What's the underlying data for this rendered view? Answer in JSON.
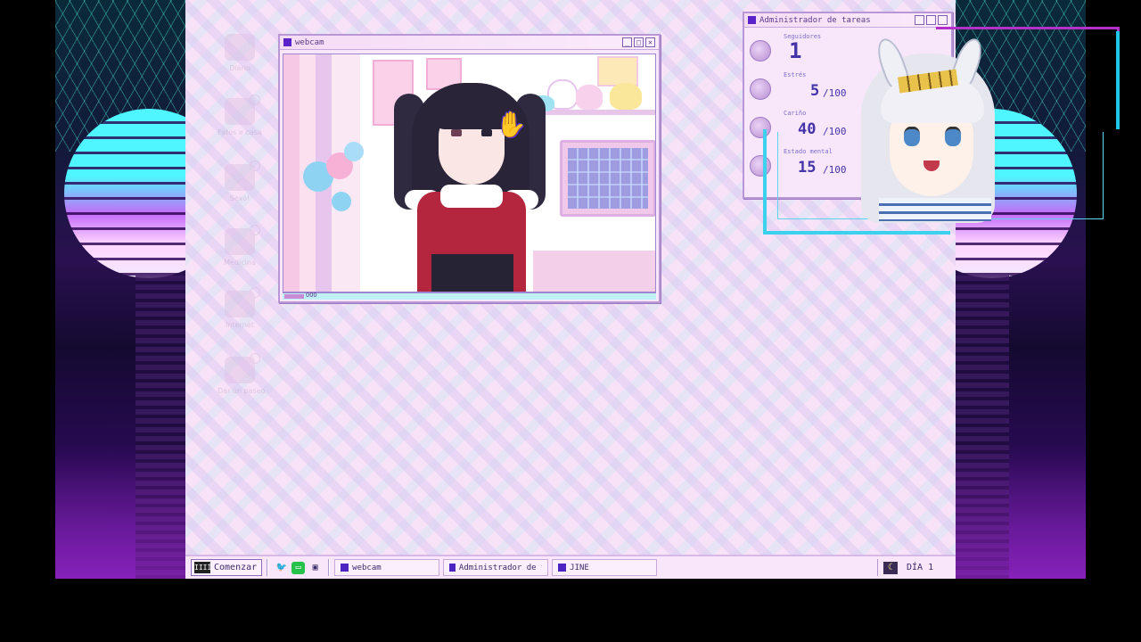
{
  "desktop": {
    "icons": [
      {
        "label": "Diario"
      },
      {
        "label": "Fatos e casa"
      },
      {
        "label": "Sexo!"
      },
      {
        "label": "Medicina"
      },
      {
        "label": "Internet"
      },
      {
        "label": "Dar un paseo"
      }
    ]
  },
  "webcam": {
    "title": "webcam",
    "status": "OOO",
    "min_glyph": "_",
    "max_glyph": "□",
    "close_glyph": "✕"
  },
  "task_manager": {
    "title": "Administrador de tareas",
    "stats": [
      {
        "name": "Seguidores",
        "value": "1",
        "max": "",
        "icon": "followers-icon"
      },
      {
        "name": "Estrés",
        "value": "5",
        "max": "/100",
        "icon": "stress-icon"
      },
      {
        "name": "Cariño",
        "value": "40",
        "max": "/100",
        "icon": "affection-icon"
      },
      {
        "name": "Estado mental",
        "value": "15",
        "max": "/100",
        "icon": "mental-state-icon"
      }
    ]
  },
  "taskbar": {
    "start_label": "Comenzar",
    "start_logo": "IIIÍ",
    "quick_launch": [
      "twitter-icon",
      "chat-icon",
      "computer-icon"
    ],
    "tasks": [
      {
        "label": "webcam"
      },
      {
        "label": "Administrador de tar..."
      },
      {
        "label": "JINE"
      }
    ],
    "tray_icon": "moon-icon",
    "day_label": "DÍA 1"
  },
  "colors": {
    "accent": "#4b24c2",
    "desktop_bg": "#f7e2f7",
    "stat_text": "#4533a8",
    "frame_magenta": "#b331c9",
    "frame_cyan": "#1fc6e8"
  }
}
